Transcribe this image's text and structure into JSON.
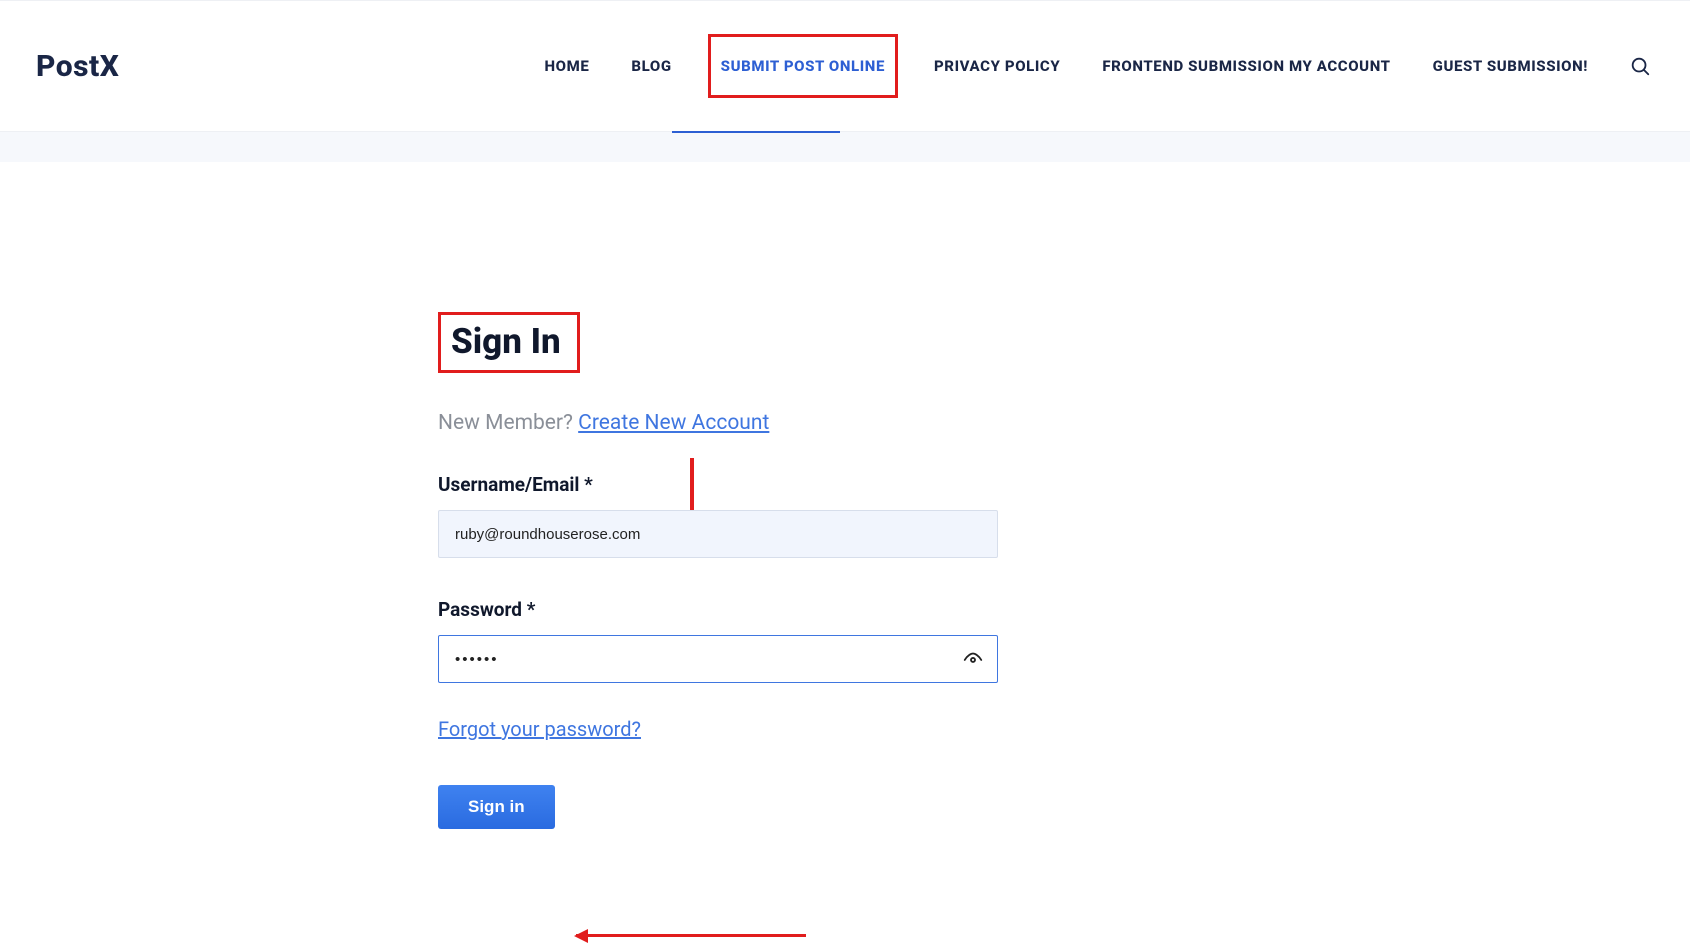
{
  "brand": "PostX",
  "nav": [
    {
      "label": "HOME"
    },
    {
      "label": "BLOG"
    },
    {
      "label": "SUBMIT POST ONLINE",
      "active": true,
      "highlighted": true
    },
    {
      "label": "PRIVACY POLICY"
    },
    {
      "label": "FRONTEND SUBMISSION MY ACCOUNT"
    },
    {
      "label": "GUEST SUBMISSION!"
    }
  ],
  "signin": {
    "title": "Sign In",
    "new_member_text": "New Member? ",
    "create_account_link": "Create New Account",
    "username_label": "Username/Email *",
    "username_value": "ruby@roundhouserose.com",
    "password_label": "Password *",
    "password_value": "••••••",
    "forgot_link": "Forgot your password?",
    "submit_label": "Sign in"
  },
  "annotations": {
    "highlight_color": "#e11d1d"
  }
}
